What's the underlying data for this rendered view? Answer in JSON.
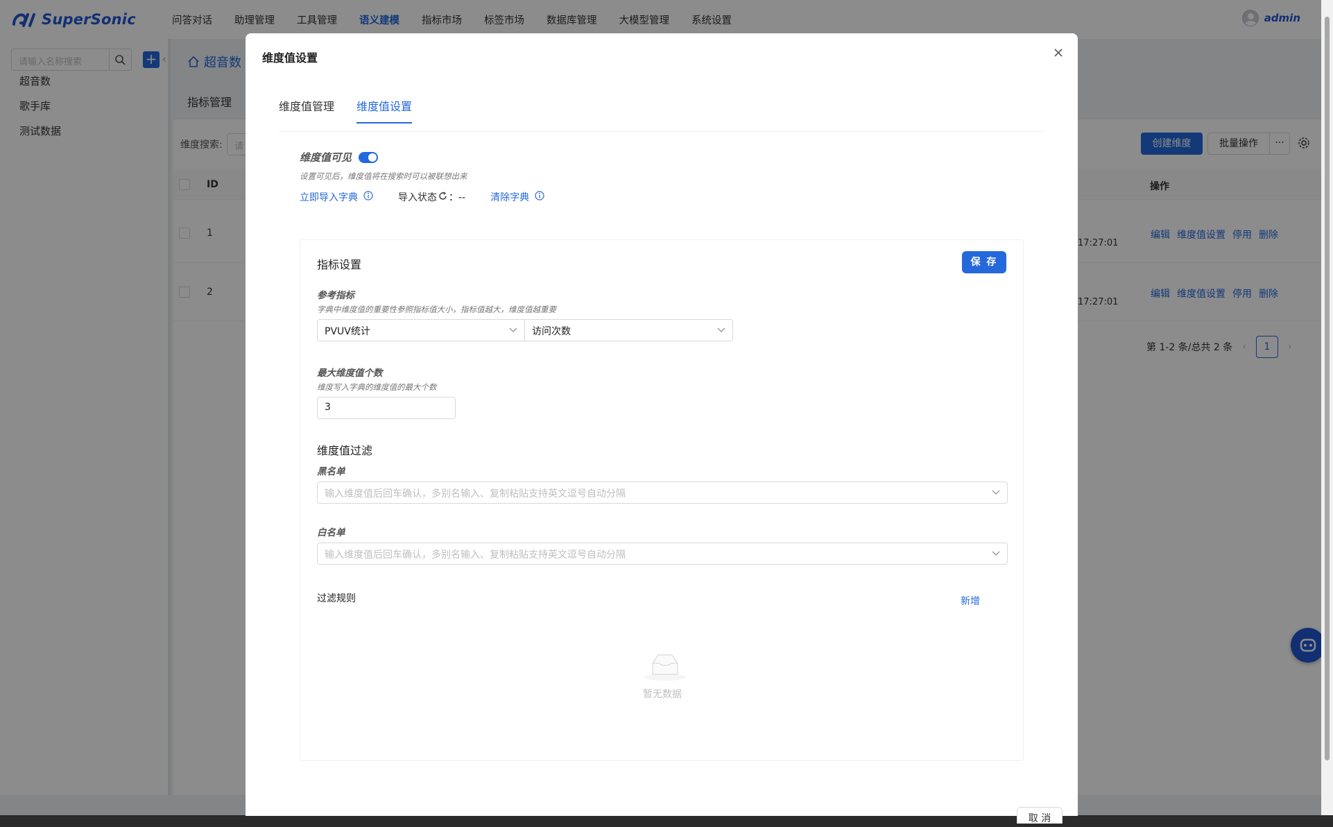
{
  "app": {
    "name": "SuperSonic",
    "user": "admin",
    "brand_color": "#2568dc"
  },
  "nav": {
    "items": [
      {
        "label": "问答对话"
      },
      {
        "label": "助理管理"
      },
      {
        "label": "工具管理"
      },
      {
        "label": "语义建模",
        "active": true
      },
      {
        "label": "指标市场"
      },
      {
        "label": "标签市场"
      },
      {
        "label": "数据库管理"
      },
      {
        "label": "大模型管理"
      },
      {
        "label": "系统设置"
      }
    ]
  },
  "sidebar": {
    "search_placeholder": "请输入名称搜索",
    "items": [
      {
        "label": "超音数"
      },
      {
        "label": "歌手库"
      },
      {
        "label": "测试数据"
      }
    ]
  },
  "main": {
    "breadcrumb": "超音数",
    "tab": "指标管理",
    "search_label": "维度搜索:",
    "search_placeholder": "请",
    "create_button": "创建维度",
    "batch_button": "批量操作",
    "more_button": "···",
    "table": {
      "col_id": "ID",
      "col_ops": "操作",
      "rows": [
        {
          "id": "1",
          "time": "17:27:01"
        },
        {
          "id": "2",
          "time": "17:27:01"
        }
      ],
      "ops": [
        "编辑",
        "维度值设置",
        "停用",
        "删除"
      ]
    },
    "pagination": {
      "summary": "第 1-2 条/总共 2 条",
      "current": "1"
    }
  },
  "modal": {
    "title": "维度值设置",
    "tabs": [
      {
        "label": "维度值管理"
      },
      {
        "label": "维度值设置",
        "active": true
      }
    ],
    "visible_label": "维度值可见",
    "visible_on": true,
    "visible_hint": "设置可见后，维度值将在搜索时可以被联想出来",
    "import_link": "立即导入字典",
    "import_status_label": "导入状态",
    "import_status_value": "：--",
    "clear_link": "清除字典",
    "settings": {
      "title": "指标设置",
      "save_button": "保 存",
      "ref_metric_label": "参考指标",
      "ref_metric_hint": "字典中维度值的重要性参照指标值大小，指标值越大，维度值越重要",
      "ref_metric_value1": "PVUV统计",
      "ref_metric_value2": "访问次数",
      "max_label": "最大维度值个数",
      "max_hint": "维度写入字典的维度值的最大个数",
      "max_value": "3",
      "filter_title": "维度值过滤",
      "blacklist_label": "黑名单",
      "blacklist_placeholder": "输入维度值后回车确认，多别名输入、复制粘贴支持英文逗号自动分隔",
      "whitelist_label": "白名单",
      "whitelist_placeholder": "输入维度值后回车确认，多别名输入、复制粘贴支持英文逗号自动分隔",
      "rules_label": "过滤规则",
      "add_link": "新增",
      "empty_text": "暂无数据"
    },
    "cancel_button": "取 消"
  }
}
